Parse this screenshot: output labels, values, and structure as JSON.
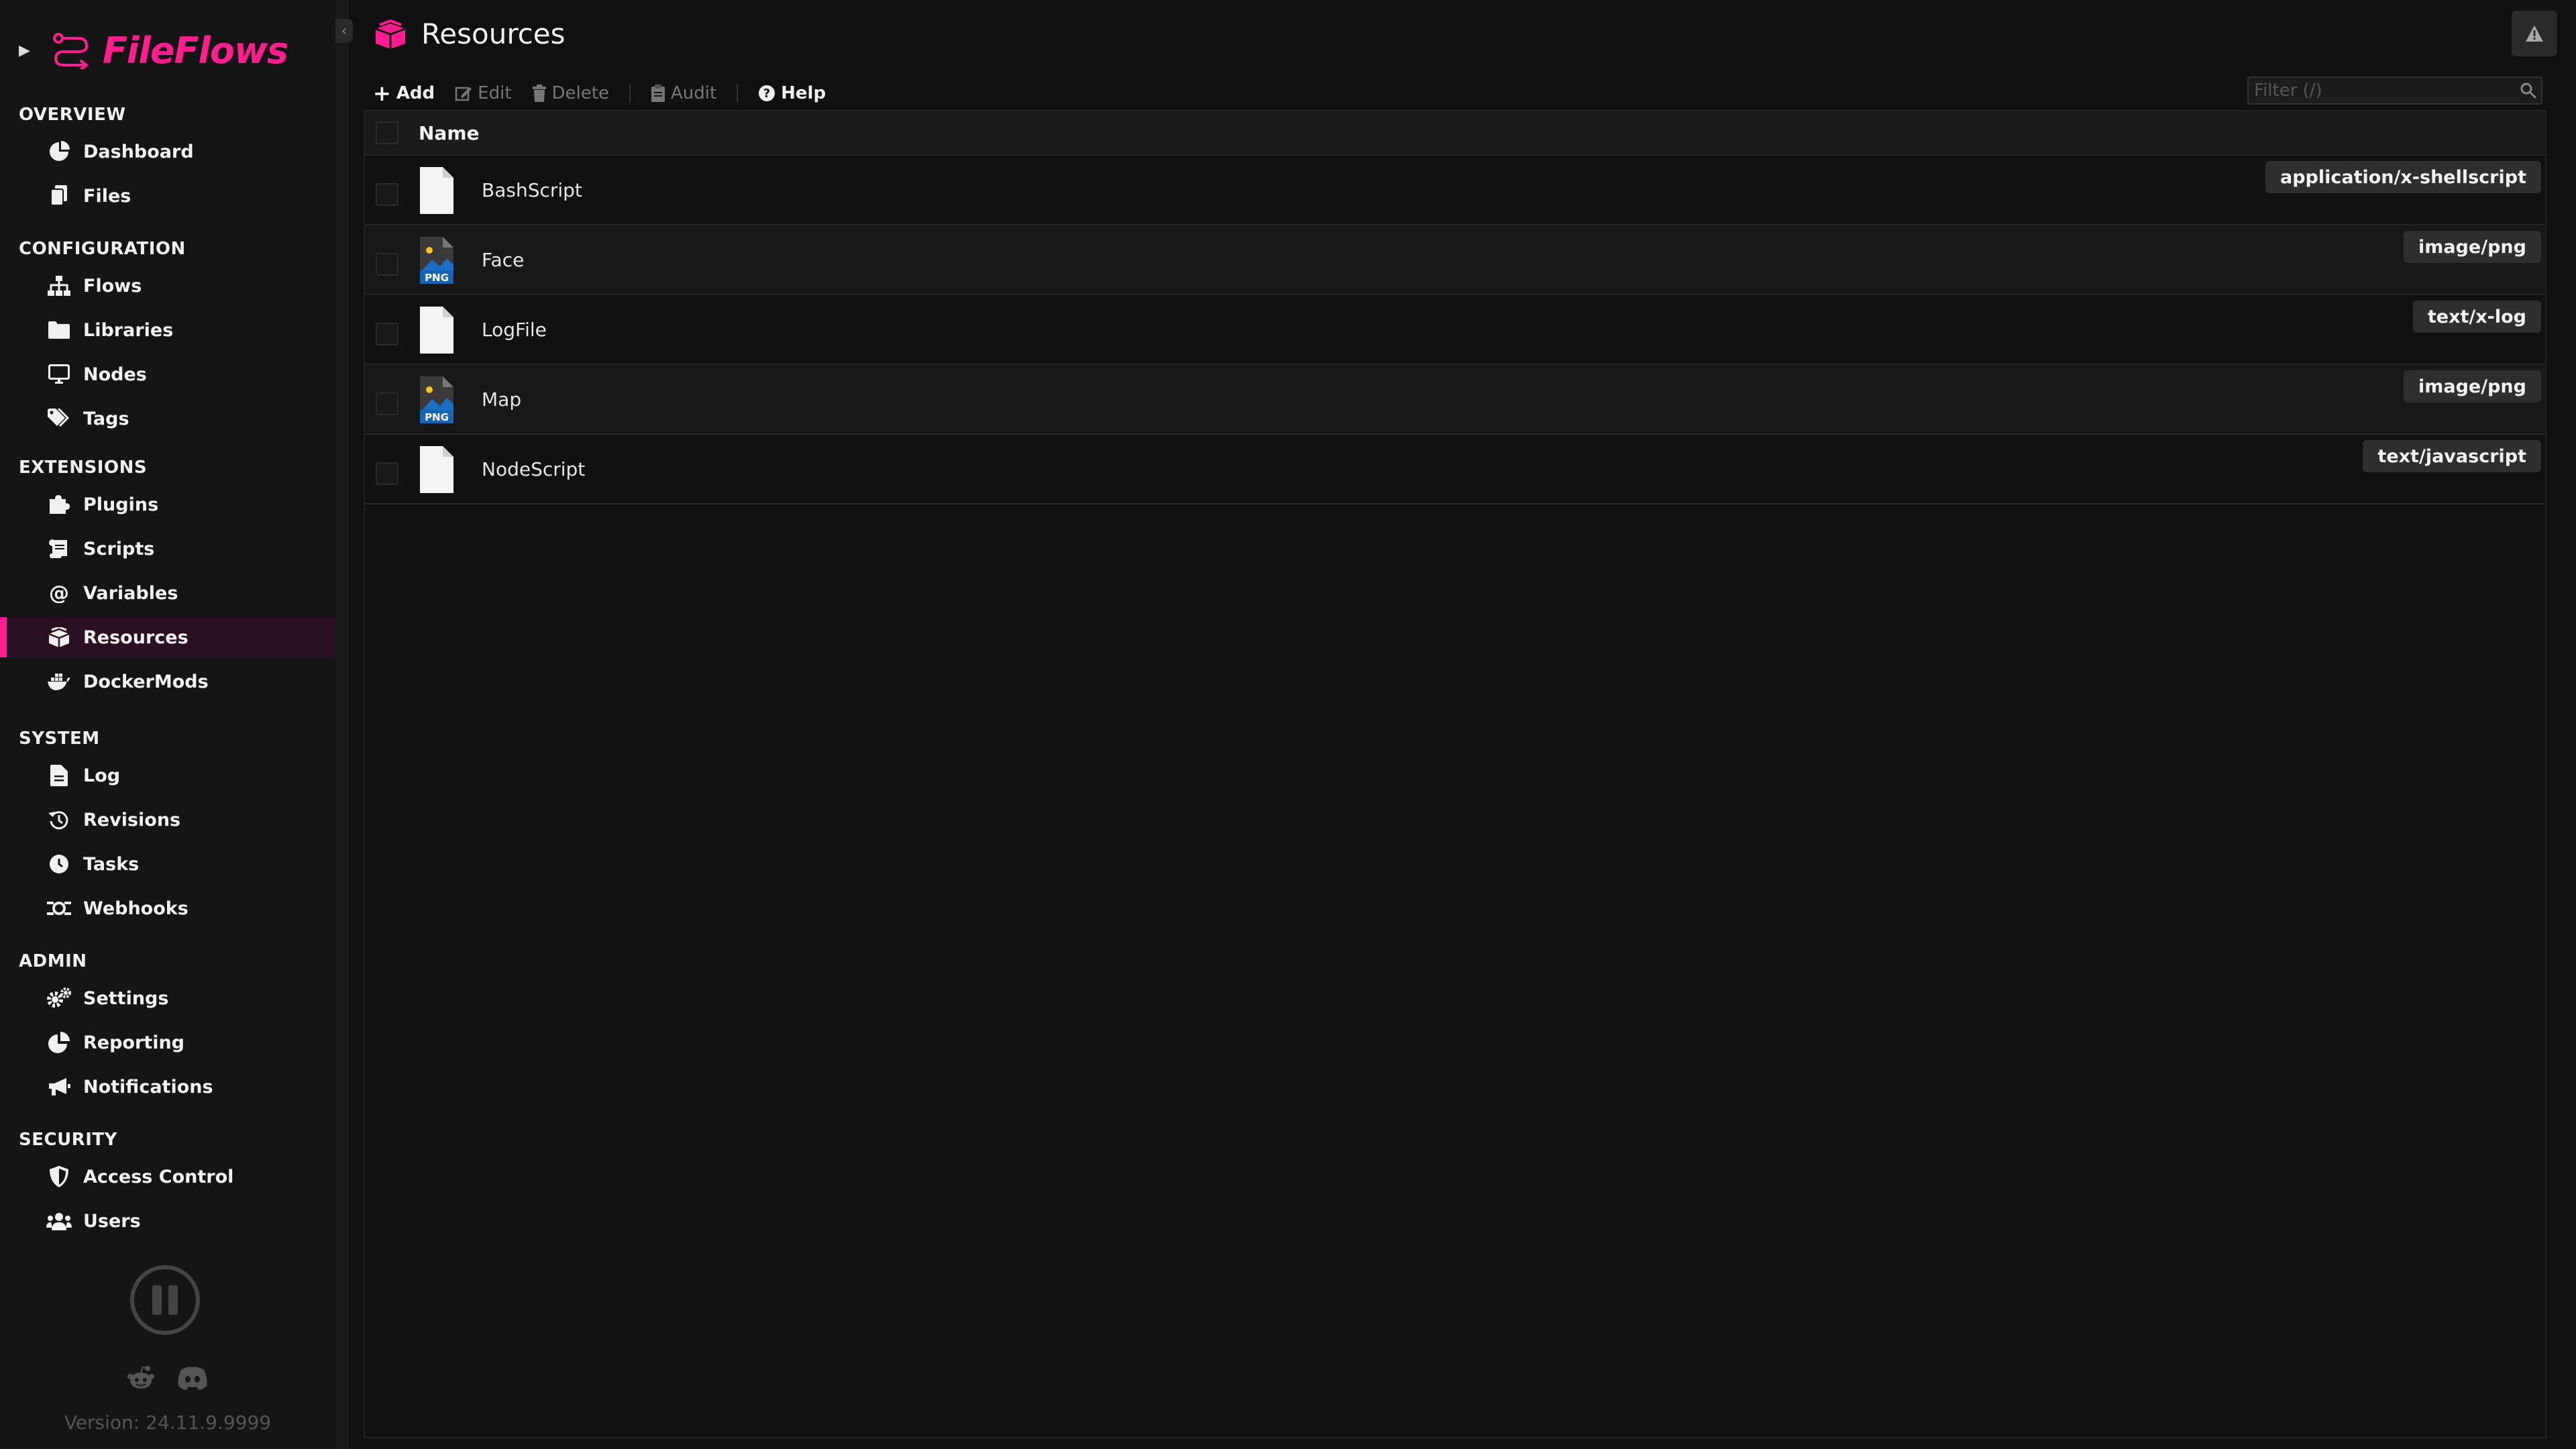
{
  "app": {
    "name": "FileFlows",
    "version": "Version: 24.11.9.9999",
    "brand_color": "#ff1e8e"
  },
  "sidebar": {
    "sections": [
      {
        "title": "OVERVIEW",
        "items": [
          {
            "label": "Dashboard",
            "icon": "dashboard-icon"
          },
          {
            "label": "Files",
            "icon": "files-icon"
          }
        ]
      },
      {
        "title": "CONFIGURATION",
        "items": [
          {
            "label": "Flows",
            "icon": "flows-icon"
          },
          {
            "label": "Libraries",
            "icon": "folder-icon"
          },
          {
            "label": "Nodes",
            "icon": "monitor-icon"
          },
          {
            "label": "Tags",
            "icon": "tags-icon"
          }
        ]
      },
      {
        "title": "EXTENSIONS",
        "items": [
          {
            "label": "Plugins",
            "icon": "puzzle-icon"
          },
          {
            "label": "Scripts",
            "icon": "scroll-icon"
          },
          {
            "label": "Variables",
            "icon": "at-icon"
          },
          {
            "label": "Resources",
            "icon": "boxes-icon",
            "active": true
          },
          {
            "label": "DockerMods",
            "icon": "docker-icon"
          }
        ]
      },
      {
        "title": "SYSTEM",
        "items": [
          {
            "label": "Log",
            "icon": "file-text-icon"
          },
          {
            "label": "Revisions",
            "icon": "history-icon"
          },
          {
            "label": "Tasks",
            "icon": "clock-icon"
          },
          {
            "label": "Webhooks",
            "icon": "webhook-icon"
          }
        ]
      },
      {
        "title": "ADMIN",
        "items": [
          {
            "label": "Settings",
            "icon": "gears-icon"
          },
          {
            "label": "Reporting",
            "icon": "chart-pie-icon"
          },
          {
            "label": "Notifications",
            "icon": "megaphone-icon"
          }
        ]
      },
      {
        "title": "SECURITY",
        "items": [
          {
            "label": "Access Control",
            "icon": "shield-icon"
          },
          {
            "label": "Users",
            "icon": "users-icon"
          }
        ]
      }
    ]
  },
  "header": {
    "title": "Resources",
    "icon": "boxes-icon"
  },
  "toolbar": {
    "add": "Add",
    "edit": "Edit",
    "delete": "Delete",
    "audit": "Audit",
    "help": "Help",
    "filter_placeholder": "Filter (/)"
  },
  "table": {
    "column_name": "Name",
    "rows": [
      {
        "name": "BashScript",
        "mime": "application/x-shellscript",
        "icon": "file-icon"
      },
      {
        "name": "Face",
        "mime": "image/png",
        "icon": "png-file-icon",
        "icon_label": "PNG"
      },
      {
        "name": "LogFile",
        "mime": "text/x-log",
        "icon": "file-icon"
      },
      {
        "name": "Map",
        "mime": "image/png",
        "icon": "png-file-icon",
        "icon_label": "PNG"
      },
      {
        "name": "NodeScript",
        "mime": "text/javascript",
        "icon": "file-icon"
      }
    ]
  }
}
